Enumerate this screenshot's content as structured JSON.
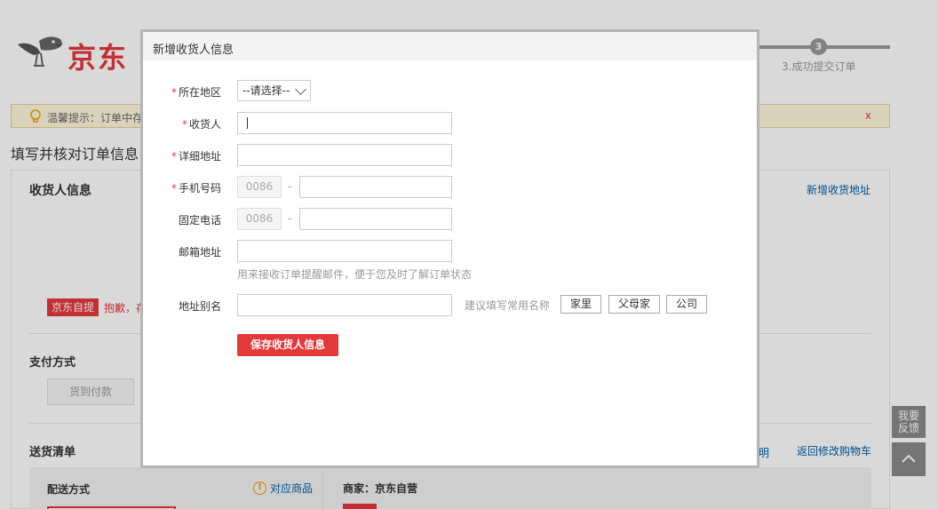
{
  "page": {
    "brand": "京东",
    "step": {
      "number": "3",
      "label": "3.成功提交订单"
    },
    "tip": {
      "text": "温馨提示：订单中存",
      "close": "x"
    },
    "section_title": "填写并核对订单信息",
    "receiver": {
      "title": "收货人信息",
      "add_link": "新增收货地址"
    },
    "self_pickup": {
      "badge": "京东自提",
      "text": "抱歉，存"
    },
    "payment": {
      "title": "支付方式",
      "cod": "货到付款"
    },
    "delivery": {
      "title": "送货清单",
      "link_partial": "明",
      "back_link": "返回修改购物车",
      "ship_method": "配送方式",
      "match_goods": "对应商品",
      "seller": "商家：京东自营"
    },
    "side": {
      "feedback": "我要\n反馈",
      "top_icon": "arrow-up-icon"
    }
  },
  "modal": {
    "title": "新增收货人信息",
    "fields": {
      "region": {
        "label": "所在地区",
        "required": true,
        "value": "--请选择--"
      },
      "receiver": {
        "label": "收货人",
        "required": true,
        "value": ""
      },
      "address": {
        "label": "详细地址",
        "required": true,
        "value": ""
      },
      "mobile": {
        "label": "手机号码",
        "required": true,
        "code": "0086",
        "value": ""
      },
      "phone": {
        "label": "固定电话",
        "required": false,
        "code": "0086",
        "value": ""
      },
      "email": {
        "label": "邮箱地址",
        "required": false,
        "value": "",
        "hint": "用来接收订单提醒邮件，便于您及时了解订单状态"
      },
      "alias": {
        "label": "地址别名",
        "required": false,
        "value": "",
        "suggest": "建议填写常用名称",
        "tags": [
          "家里",
          "父母家",
          "公司"
        ]
      }
    },
    "required_mark": "*",
    "dash": "-",
    "save_button": "保存收货人信息"
  },
  "colors": {
    "accent": "#e4393c",
    "link": "#005ea7"
  }
}
